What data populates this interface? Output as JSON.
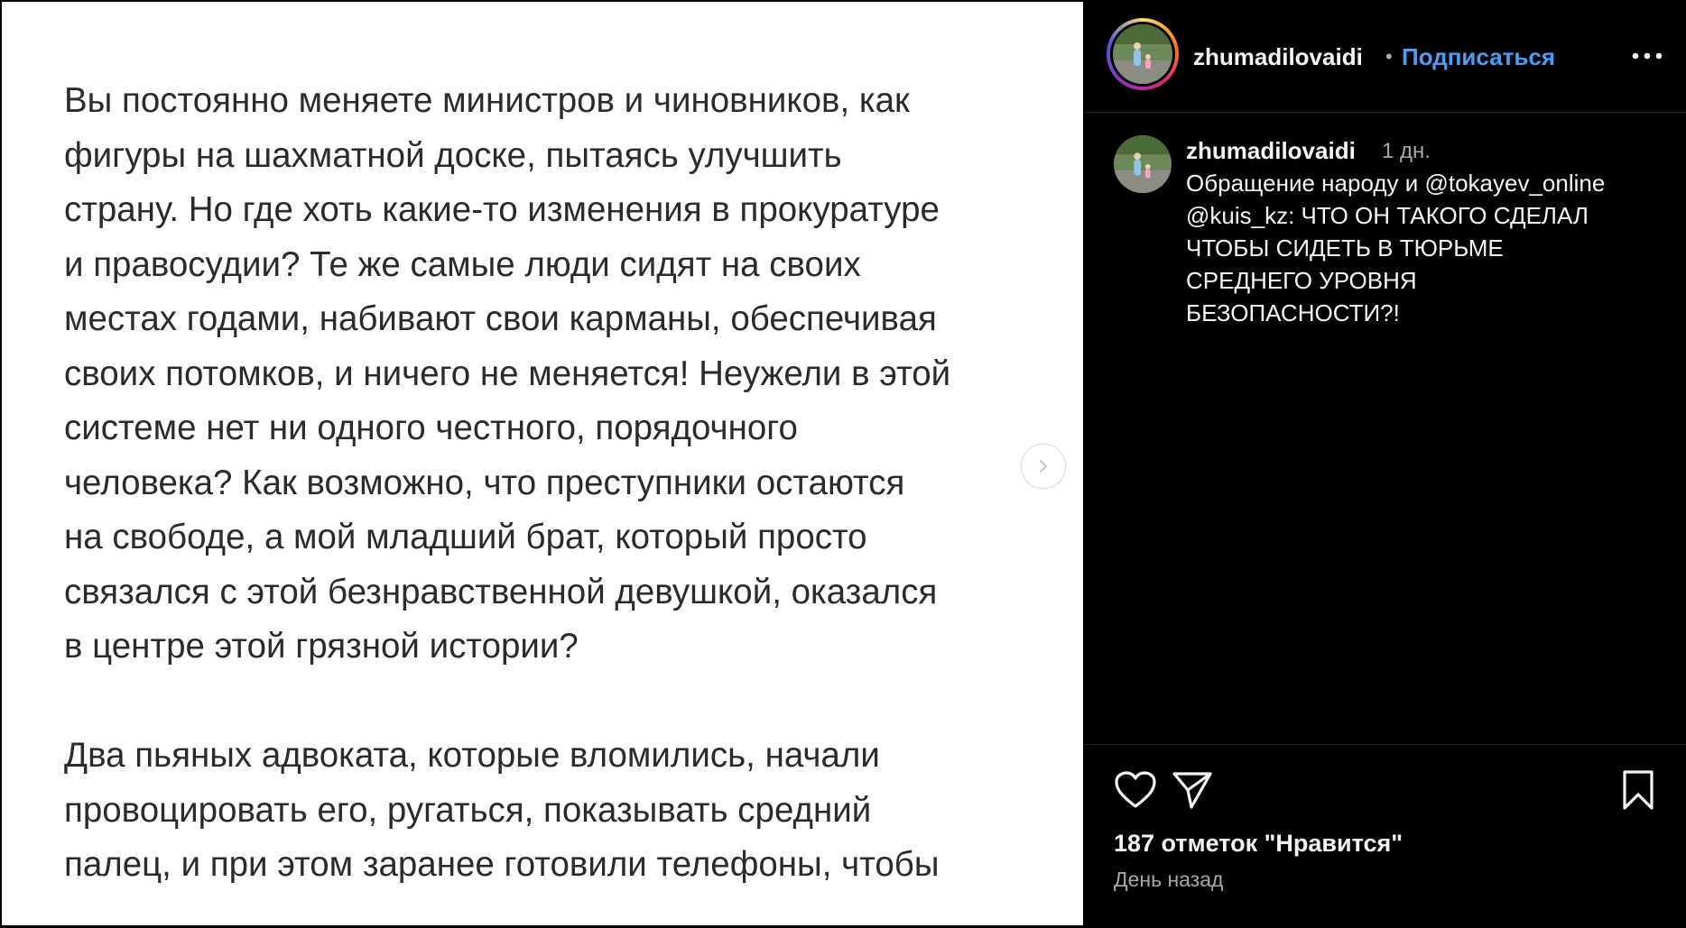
{
  "post": {
    "paragraphs": [
      "Вы постоянно меняете министров и чиновников, как\nфигуры на шахматной доске, пытаясь улучшить\nстрану. Но где хоть какие-то изменения в прокуратуре\nи правосудии? Те же самые люди сидят на своих\nместах годами, набивают свои карманы, обеспечивая\nсвоих потомков, и ничего не меняется! Неужели в этой\nсистеме нет ни одного честного, порядочного\nчеловека? Как возможно, что преступники остаются\nна свободе, а мой младший брат, который просто\nсвязался с этой безнравственной девушкой, оказался\nв центре этой грязной истории?",
      "Два пьяных адвоката, которые вломились, начали\nпровоцировать его, ругаться, показывать средний\nпалец, и при этом заранее готовили телефоны, чтобы"
    ]
  },
  "header": {
    "username": "zhumadilovaidi",
    "separator": "•",
    "follow_label": "Подписаться"
  },
  "caption": {
    "username": "zhumadilovaidi",
    "time": "1 дн.",
    "text": "Обращение народу и @tokayev_online\n@kuis_kz: ЧТО ОН ТАКОГО СДЕЛАЛ\nЧТОБЫ СИДЕТЬ В ТЮРЬМЕ\nСРЕДНЕГО УРОВНЯ\nБЕЗОПАСНОСТИ?!"
  },
  "footer": {
    "likes": "187 отметок \"Нравится\"",
    "date": "День назад"
  },
  "icons": {
    "more": "more-options-icon",
    "like": "heart-icon",
    "share": "send-icon",
    "save": "bookmark-icon",
    "next": "chevron-right-icon"
  },
  "colors": {
    "follow": "#4a9ff5",
    "background": "#000000",
    "media_background": "#ffffff",
    "secondary_text": "#a8a8a8"
  }
}
